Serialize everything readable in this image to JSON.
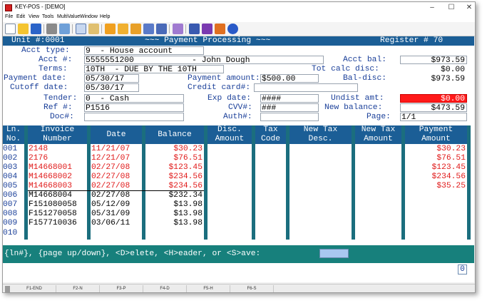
{
  "window": {
    "title": "KEY-POS - [DEMO]"
  },
  "menu": [
    "File",
    "Edit",
    "View",
    "Tools",
    "MultiValue",
    "Window",
    "Help"
  ],
  "header": {
    "unit": "Unit #:0001",
    "title": "~~~ Payment Processing ~~~",
    "register": "Register # 70"
  },
  "form": {
    "acct_type_label": "Acct type:",
    "acct_type": "9  - House account",
    "acct_num_label": "Acct #:",
    "acct_num": "5555551200            - John Dough",
    "terms_label": "Terms:",
    "terms": "10TH  - DUE BY THE 10TH",
    "payment_date_label": "Payment date:",
    "payment_date": "05/30/17",
    "cutoff_date_label": "Cutoff date:",
    "cutoff_date": "05/30/17",
    "tender_label": "Tender:",
    "tender": "0  - Cash",
    "ref_label": "Ref #:",
    "ref": "P1516",
    "doc_label": "Doc#:",
    "doc": "",
    "payment_amount_label": "Payment amount:",
    "payment_amount": "$500.00",
    "credit_card_label": "Credit card#:",
    "credit_card": "",
    "exp_date_label": "Exp date:",
    "exp_date": "####",
    "cvv_label": "CVV#:",
    "cvv": "###",
    "auth_label": "Auth#:",
    "auth": "",
    "acct_bal_label": "Acct bal:",
    "acct_bal": "$973.59",
    "tot_calc_disc_label": "Tot calc disc:",
    "tot_calc_disc": "$0.00",
    "bal_disc_label": "Bal-disc:",
    "bal_disc": "$973.59",
    "undist_amt_label": "Undist amt:",
    "undist_amt": "$0.00",
    "new_balance_label": "New balance:",
    "new_balance": "$473.59",
    "page_label": "Page:",
    "page": "1/1"
  },
  "table": {
    "columns": {
      "ln": "Ln.\nNo.",
      "invoice": "Invoice\nNumber",
      "date": "Date",
      "balance": "Balance",
      "disc": "Disc.\nAmount",
      "tax_code": "Tax\nCode",
      "new_tax_desc": "New Tax\nDesc.",
      "new_tax_amount": "New Tax\nAmount",
      "payment_amount": "Payment\nAmount"
    },
    "rows": [
      {
        "ln": "001",
        "invoice": "2148",
        "date": "11/21/07",
        "balance": "$30.23",
        "payment": "$30.23",
        "status": "paid"
      },
      {
        "ln": "002",
        "invoice": "2176",
        "date": "12/21/07",
        "balance": "$76.51",
        "payment": "$76.51",
        "status": "paid"
      },
      {
        "ln": "003",
        "invoice": "M14668001",
        "date": "02/27/08",
        "balance": "$123.45",
        "payment": "$123.45",
        "status": "paid"
      },
      {
        "ln": "004",
        "invoice": "M14668002",
        "date": "02/27/08",
        "balance": "$234.56",
        "payment": "$234.56",
        "status": "paid"
      },
      {
        "ln": "005",
        "invoice": "M14668003",
        "date": "02/27/08",
        "balance": "$234.56",
        "payment": "$35.25",
        "status": "paid"
      },
      {
        "ln": "006",
        "invoice": "M14668004",
        "date": "02/27/08",
        "balance": "$232.34",
        "payment": "",
        "status": "open"
      },
      {
        "ln": "007",
        "invoice": "F151080058",
        "date": "05/12/09",
        "balance": "$13.98",
        "payment": "",
        "status": "open"
      },
      {
        "ln": "008",
        "invoice": "F151270058",
        "date": "05/31/09",
        "balance": "$13.98",
        "payment": "",
        "status": "open"
      },
      {
        "ln": "009",
        "invoice": "F157710036",
        "date": "03/06/11",
        "balance": "$13.98",
        "payment": "",
        "status": "open"
      },
      {
        "ln": "010",
        "invoice": "",
        "date": "",
        "balance": "",
        "payment": "",
        "status": "open"
      }
    ]
  },
  "command": {
    "prompt": "{ln#}, {page up/down}, <D>elete, <H>eader, or <S>ave:",
    "value": ""
  },
  "cursor_indicator": "0",
  "function_keys": [
    "F1-END",
    "F2-N",
    "F3-P",
    "F4-D",
    "F5-H",
    "F6-S"
  ],
  "colors": {
    "header_blue": "#1b5e96",
    "label_blue": "#1a3f99",
    "paid_red": "#e01818",
    "cmd_teal": "#17807c",
    "alert_red": "#ff1a1a"
  }
}
